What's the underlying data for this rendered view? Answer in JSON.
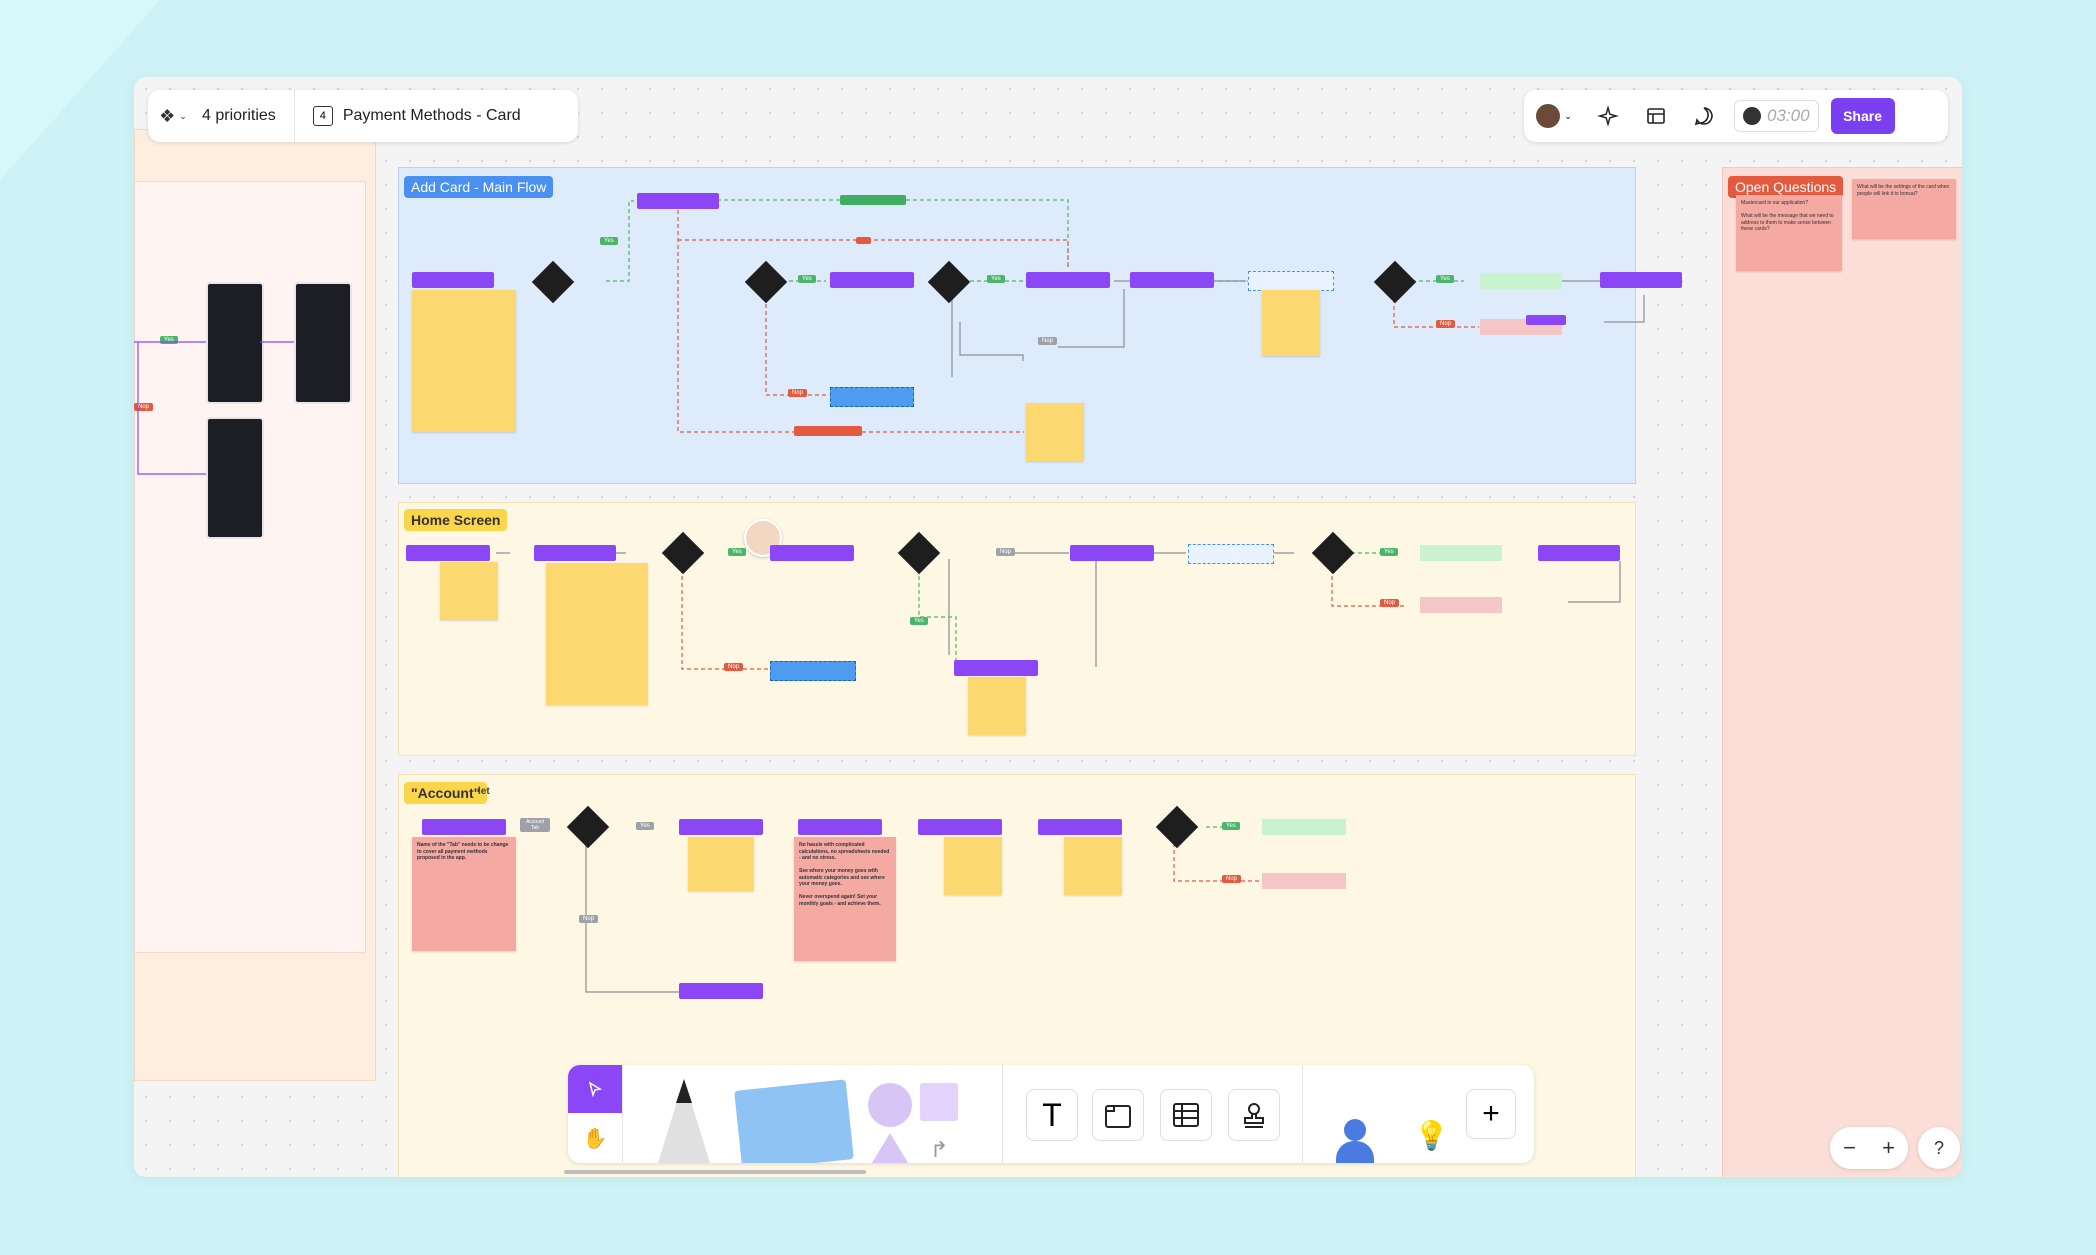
{
  "topbar": {
    "priorities": "4 priorities",
    "page_number": "4",
    "page_title": "Payment Methods - Card",
    "timer": "03:00",
    "share": "Share"
  },
  "sections": {
    "add_card": "Add Card - Main Flow",
    "home": "Home Screen",
    "account": "\"Account\"",
    "account_suffix": "let",
    "open_questions": "Open Questions"
  },
  "labels": {
    "yes": "Yes",
    "nop": "Nop",
    "account_tab": "Account Tab"
  },
  "open_questions": {
    "q1": "What will be the message that we need to address to them to make sense between these cards?",
    "q1_top": "Mastercard in our application?",
    "q2": "What will be the settings of the card when people will link it to bonsai?"
  },
  "stickies": {
    "account_main": "Name of the \"Tab\" needs to be change to cover all payment methods proposed in the app.",
    "no_hassle": "No hassle with complicated calculations, no spreadsheets needed - and no stress.",
    "see_where": "See where your money goes with automatic categories and see where your money goes.",
    "never_over": "Never overspend again! Set your monthly goals - and achieve them."
  },
  "toolbar": {
    "tools": [
      "pointer-tool",
      "hand-tool",
      "pen-tool",
      "sticky-tool",
      "shapes-tool",
      "text-tool",
      "frame-tool",
      "table-tool",
      "stamp-tool",
      "widget-tool",
      "add-tool"
    ]
  },
  "zoom": {
    "minus": "−",
    "plus": "+",
    "help": "?"
  }
}
